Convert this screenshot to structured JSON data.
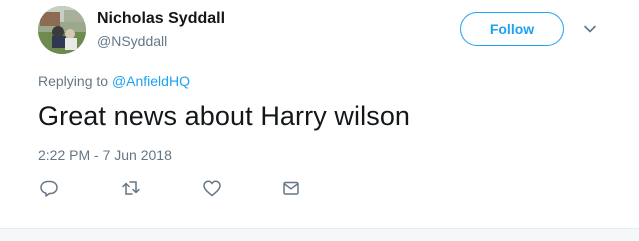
{
  "tweet": {
    "author_name": "Nicholas Syddall",
    "author_handle": "@NSyddall",
    "follow_label": "Follow",
    "replying_prefix": "Replying to ",
    "replying_to": "@AnfieldHQ",
    "text": "Great news about Harry wilson",
    "timestamp": "2:22 PM - 7 Jun 2018"
  },
  "icons": {
    "caret": "chevron-down-icon",
    "reply": "reply-icon",
    "retweet": "retweet-icon",
    "like": "heart-icon",
    "message": "envelope-icon"
  },
  "colors": {
    "accent": "#1da1f2",
    "secondary_text": "#657786",
    "primary_text": "#14171a"
  }
}
